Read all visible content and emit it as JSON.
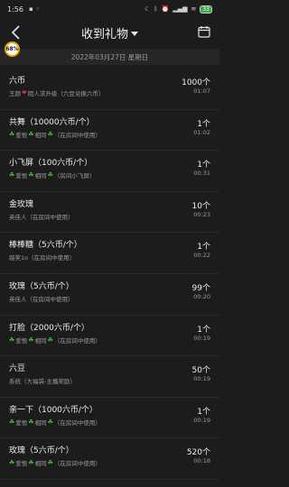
{
  "status_bar": {
    "time": "1:56",
    "battery": "33"
  },
  "header": {
    "title": "收到礼物"
  },
  "progress_badge": "68%",
  "date": "2022年03月27日 星期日",
  "items": [
    {
      "name": "六币",
      "sender": "王颜",
      "sub_parts": [
        "王颜",
        "heart",
        "陌人求升级（六豆兑换六币）"
      ],
      "count": "1000个",
      "time": "01:07"
    },
    {
      "name": "共舞（10000六币/个）",
      "sub_parts": [
        "clover",
        "爱恨",
        "clover",
        "相同",
        "clover",
        "（在房间中使用）"
      ],
      "count": "1个",
      "time": "01:02"
    },
    {
      "name": "小飞屏（100六币/个）",
      "sub_parts": [
        "clover",
        "爱恨",
        "clover",
        "相同",
        "clover",
        "（房间小飞屏）"
      ],
      "count": "1个",
      "time": "00:31"
    },
    {
      "name": "金玫瑰",
      "sub_parts": [
        "英佳人（在房间中使用）"
      ],
      "count": "10个",
      "time": "00:23"
    },
    {
      "name": "棒棒糖（5六币/个）",
      "sub_parts": [
        "踮笑1o（在房间中使用）"
      ],
      "count": "1个",
      "time": "00:22"
    },
    {
      "name": "玫瑰（5六币/个）",
      "sub_parts": [
        "英佳人（在房间中使用）"
      ],
      "count": "99个",
      "time": "00:20"
    },
    {
      "name": "打脸（2000六币/个）",
      "sub_parts": [
        "clover",
        "爱恨",
        "clover",
        "相同",
        "clover",
        "（在房间中使用）"
      ],
      "count": "1个",
      "time": "00:19"
    },
    {
      "name": "六豆",
      "sub_parts": [
        "系统（大福袋-主播奖励）"
      ],
      "count": "50个",
      "time": "00:19"
    },
    {
      "name": "亲一下（1000六币/个）",
      "sub_parts": [
        "clover",
        "爱恨",
        "clover",
        "相同",
        "clover",
        "（在房间中使用）"
      ],
      "count": "1个",
      "time": "00:19"
    },
    {
      "name": "玫瑰（5六币/个）",
      "sub_parts": [
        "clover",
        "爱恨",
        "clover",
        "相同",
        "clover",
        "（在房间中使用）"
      ],
      "count": "520个",
      "time": "00:18"
    }
  ]
}
